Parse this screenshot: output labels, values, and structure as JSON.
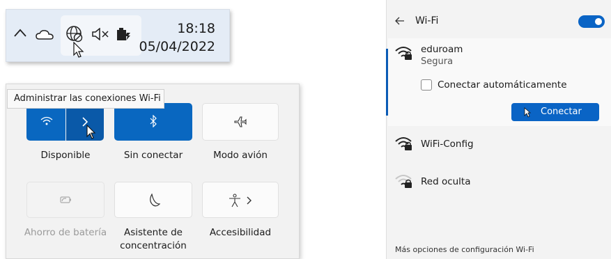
{
  "tray": {
    "icons": [
      "chevron-up-icon",
      "onedrive-cloud-icon",
      "globe-no-connection-icon",
      "speaker-muted-icon",
      "battery-charging-icon"
    ],
    "time": "18:18",
    "date": "05/04/2022"
  },
  "tooltip": {
    "text": "Administrar las conexiones Wi-Fi"
  },
  "quick_settings": {
    "tiles": [
      {
        "label": "Disponible",
        "icon": "wifi-icon",
        "state": "on"
      },
      {
        "label": "Sin conectar",
        "icon": "bluetooth-icon",
        "state": "on"
      },
      {
        "label": "Modo avión",
        "icon": "airplane-icon",
        "state": "off"
      },
      {
        "label": "Ahorro de batería",
        "icon": "battery-saver-icon",
        "state": "disabled"
      },
      {
        "label": "Asistente de concentración",
        "icon": "moon-icon",
        "state": "off"
      },
      {
        "label": "Accesibilidad",
        "icon": "accessibility-icon",
        "state": "off"
      }
    ]
  },
  "wifi_panel": {
    "title": "Wi-Fi",
    "toggle_on": true,
    "networks": [
      {
        "name": "eduroam",
        "status": "Segura",
        "icon": "wifi-lock-icon",
        "expanded": true
      },
      {
        "name": "WiFi-Config",
        "icon": "wifi-lock-icon"
      },
      {
        "name": "Red oculta",
        "icon": "wifi-lock-weak-icon"
      }
    ],
    "auto_connect_label": "Conectar automáticamente",
    "connect_label": "Conectar",
    "more_options": "Más opciones de configuración Wi-Fi"
  },
  "colors": {
    "accent": "#0967c0",
    "selection_bar": "#0a5bb5"
  }
}
